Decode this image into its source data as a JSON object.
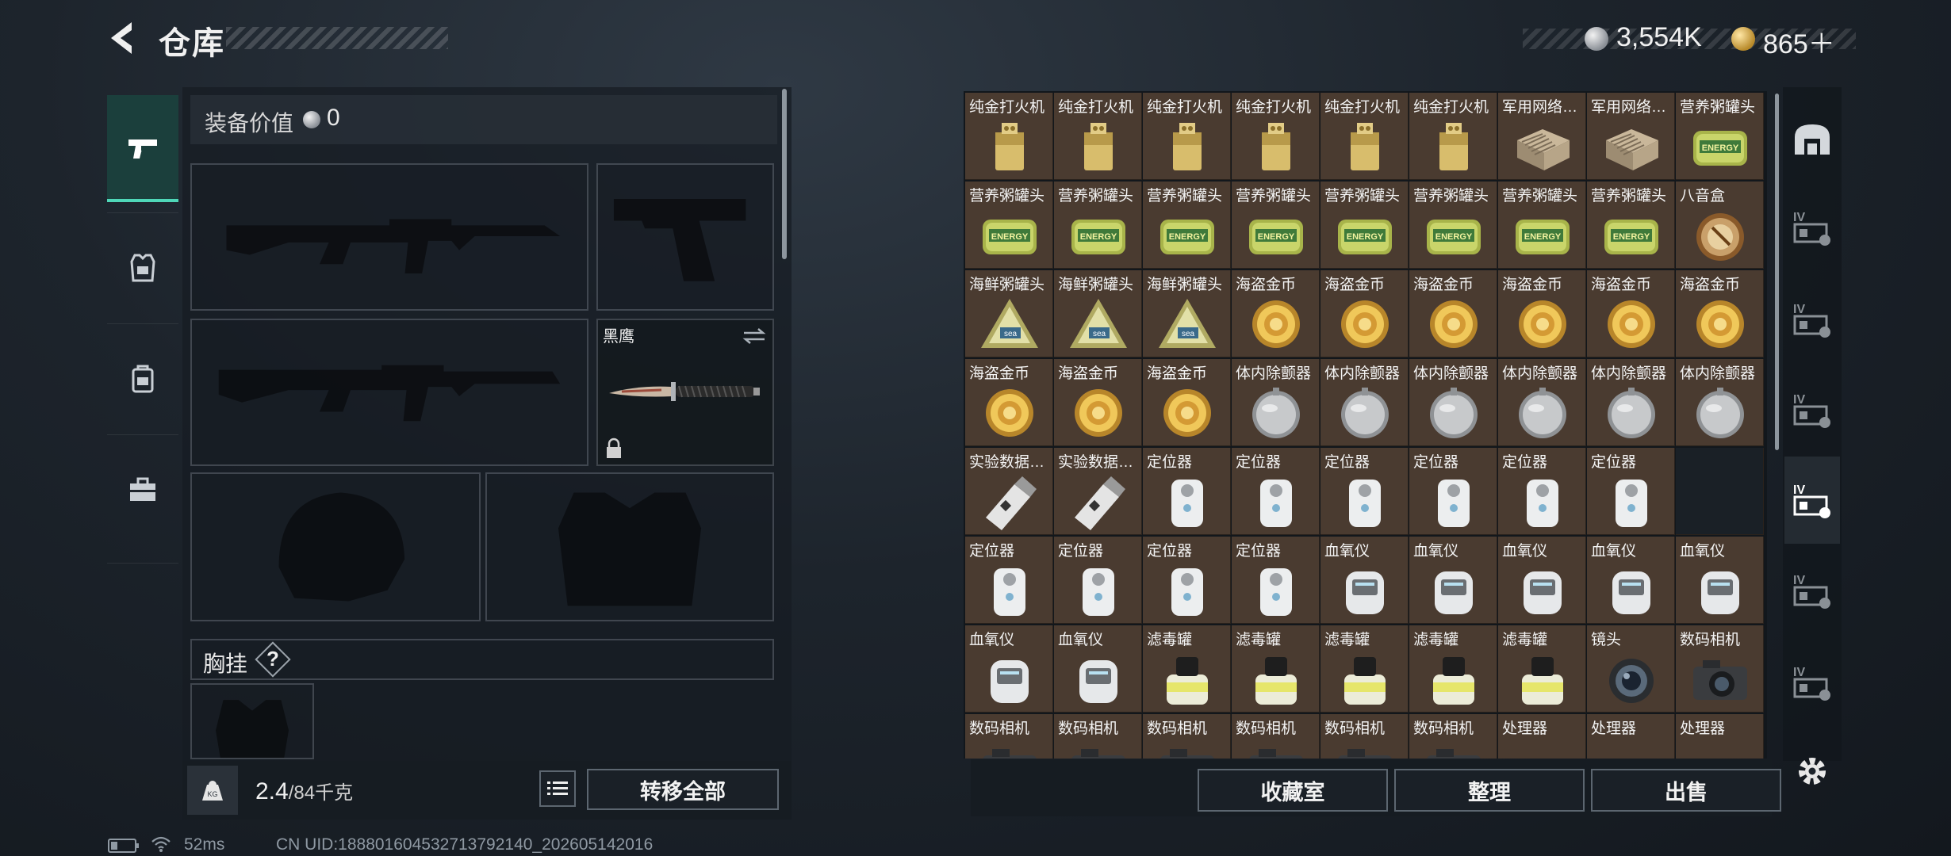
{
  "header": {
    "title": "仓库",
    "silver_amount": "3,554K",
    "gold_amount": "865＋"
  },
  "left_tabs": [
    {
      "name": "weapon",
      "icon": "pistol-icon"
    },
    {
      "name": "armor",
      "icon": "armor-icon"
    },
    {
      "name": "backpack",
      "icon": "backpack-icon"
    },
    {
      "name": "case",
      "icon": "toolbox-icon"
    }
  ],
  "equipment": {
    "value_label": "装备价值",
    "value": "0",
    "melee_name": "黑鹰",
    "chest_rig_label": "胸挂",
    "chest_rig_help": "?"
  },
  "bottom_bar": {
    "weight_current": "2.4",
    "weight_max": "/84千克",
    "transfer_all": "转移全部"
  },
  "inventory": {
    "items": [
      {
        "label": "纯金打火机",
        "icon": "lighter"
      },
      {
        "label": "纯金打火机",
        "icon": "lighter"
      },
      {
        "label": "纯金打火机",
        "icon": "lighter"
      },
      {
        "label": "纯金打火机",
        "icon": "lighter"
      },
      {
        "label": "纯金打火机",
        "icon": "lighter"
      },
      {
        "label": "纯金打火机",
        "icon": "lighter"
      },
      {
        "label": "军用网络…",
        "icon": "router"
      },
      {
        "label": "军用网络…",
        "icon": "router"
      },
      {
        "label": "营养粥罐头",
        "icon": "can"
      },
      {
        "label": "营养粥罐头",
        "icon": "can"
      },
      {
        "label": "营养粥罐头",
        "icon": "can"
      },
      {
        "label": "营养粥罐头",
        "icon": "can"
      },
      {
        "label": "营养粥罐头",
        "icon": "can"
      },
      {
        "label": "营养粥罐头",
        "icon": "can"
      },
      {
        "label": "营养粥罐头",
        "icon": "can"
      },
      {
        "label": "营养粥罐头",
        "icon": "can"
      },
      {
        "label": "营养粥罐头",
        "icon": "can"
      },
      {
        "label": "八音盒",
        "icon": "musicbox"
      },
      {
        "label": "海鲜粥罐头",
        "icon": "triangle-can"
      },
      {
        "label": "海鲜粥罐头",
        "icon": "triangle-can"
      },
      {
        "label": "海鲜粥罐头",
        "icon": "triangle-can"
      },
      {
        "label": "海盗金币",
        "icon": "coin"
      },
      {
        "label": "海盗金币",
        "icon": "coin"
      },
      {
        "label": "海盗金币",
        "icon": "coin"
      },
      {
        "label": "海盗金币",
        "icon": "coin"
      },
      {
        "label": "海盗金币",
        "icon": "coin"
      },
      {
        "label": "海盗金币",
        "icon": "coin"
      },
      {
        "label": "海盗金币",
        "icon": "coin"
      },
      {
        "label": "海盗金币",
        "icon": "coin"
      },
      {
        "label": "海盗金币",
        "icon": "coin"
      },
      {
        "label": "体内除颤器",
        "icon": "defib"
      },
      {
        "label": "体内除颤器",
        "icon": "defib"
      },
      {
        "label": "体内除颤器",
        "icon": "defib"
      },
      {
        "label": "体内除颤器",
        "icon": "defib"
      },
      {
        "label": "体内除颤器",
        "icon": "defib"
      },
      {
        "label": "体内除颤器",
        "icon": "defib"
      },
      {
        "label": "实验数据…",
        "icon": "usb"
      },
      {
        "label": "实验数据…",
        "icon": "usb"
      },
      {
        "label": "定位器",
        "icon": "tracker"
      },
      {
        "label": "定位器",
        "icon": "tracker"
      },
      {
        "label": "定位器",
        "icon": "tracker"
      },
      {
        "label": "定位器",
        "icon": "tracker"
      },
      {
        "label": "定位器",
        "icon": "tracker"
      },
      {
        "label": "定位器",
        "icon": "tracker"
      },
      {
        "label": "",
        "icon": "empty"
      },
      {
        "label": "定位器",
        "icon": "tracker"
      },
      {
        "label": "定位器",
        "icon": "tracker"
      },
      {
        "label": "定位器",
        "icon": "tracker"
      },
      {
        "label": "定位器",
        "icon": "tracker"
      },
      {
        "label": "血氧仪",
        "icon": "oximeter"
      },
      {
        "label": "血氧仪",
        "icon": "oximeter"
      },
      {
        "label": "血氧仪",
        "icon": "oximeter"
      },
      {
        "label": "血氧仪",
        "icon": "oximeter"
      },
      {
        "label": "血氧仪",
        "icon": "oximeter"
      },
      {
        "label": "血氧仪",
        "icon": "oximeter"
      },
      {
        "label": "血氧仪",
        "icon": "oximeter"
      },
      {
        "label": "滤毒罐",
        "icon": "filter"
      },
      {
        "label": "滤毒罐",
        "icon": "filter"
      },
      {
        "label": "滤毒罐",
        "icon": "filter"
      },
      {
        "label": "滤毒罐",
        "icon": "filter"
      },
      {
        "label": "滤毒罐",
        "icon": "filter"
      },
      {
        "label": "镜头",
        "icon": "lens"
      },
      {
        "label": "数码相机",
        "icon": "camera"
      },
      {
        "label": "数码相机",
        "icon": "camera"
      },
      {
        "label": "数码相机",
        "icon": "camera"
      },
      {
        "label": "数码相机",
        "icon": "camera"
      },
      {
        "label": "数码相机",
        "icon": "camera"
      },
      {
        "label": "数码相机",
        "icon": "camera"
      },
      {
        "label": "数码相机",
        "icon": "camera"
      },
      {
        "label": "处理器",
        "icon": "processor"
      },
      {
        "label": "处理器",
        "icon": "processor"
      },
      {
        "label": "处理器",
        "icon": "processor"
      }
    ]
  },
  "right_actions": {
    "collection": "收藏室",
    "organize": "整理",
    "sell": "出售"
  },
  "right_tabs": [
    "warehouse-icon",
    "storage-iv-1-icon",
    "storage-iv-2-icon",
    "storage-iv-3-icon",
    "storage-iv-4-icon",
    "storage-iv-5-icon",
    "storage-iv-6-icon"
  ],
  "status_bar": {
    "ping": "52ms",
    "uid": "CN UID:18880160453271379214​0_202605142016"
  },
  "colors": {
    "accent": "#4fd7b8",
    "cell_bg": "#4a3b30",
    "gold": "#d4a83c"
  }
}
